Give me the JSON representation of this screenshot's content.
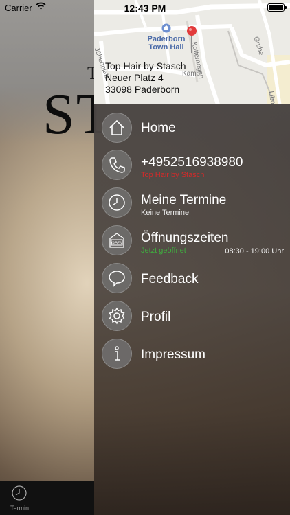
{
  "status_bar": {
    "carrier": "Carrier",
    "time": "12:43 PM"
  },
  "background": {
    "logo_top": "T",
    "logo_main": "ST"
  },
  "tabbar": {
    "termin_label": "Termin"
  },
  "map": {
    "poi_label_line1": "Paderborn",
    "poi_label_line2": "Town Hall",
    "streets": [
      "Kotterhagen",
      "Grube",
      "Kamp",
      "Jühenplatz",
      "Libo"
    ]
  },
  "salon": {
    "name": "Top Hair by Stasch",
    "street": "Neuer Platz 4",
    "city": "33098 Paderborn"
  },
  "menu": {
    "home": {
      "label": "Home",
      "icon": "home-icon"
    },
    "phone": {
      "label": "+4952516938980",
      "sub": "Top Hair by Stasch",
      "sub_color": "#d42a2a",
      "icon": "phone-icon"
    },
    "appointments": {
      "label": "Meine Termine",
      "sub": "Keine Termine",
      "icon": "clock-icon"
    },
    "hours": {
      "label": "Öffnungszeiten",
      "sub": "Jetzt geöffnet",
      "sub_color": "#3fae3f",
      "time": "08:30 - 19:00 Uhr",
      "icon": "open-sign-icon",
      "sign_text": "OPEN"
    },
    "feedback": {
      "label": "Feedback",
      "icon": "speech-bubble-icon"
    },
    "profile": {
      "label": "Profil",
      "icon": "gear-icon"
    },
    "imprint": {
      "label": "Impressum",
      "icon": "info-icon"
    }
  }
}
